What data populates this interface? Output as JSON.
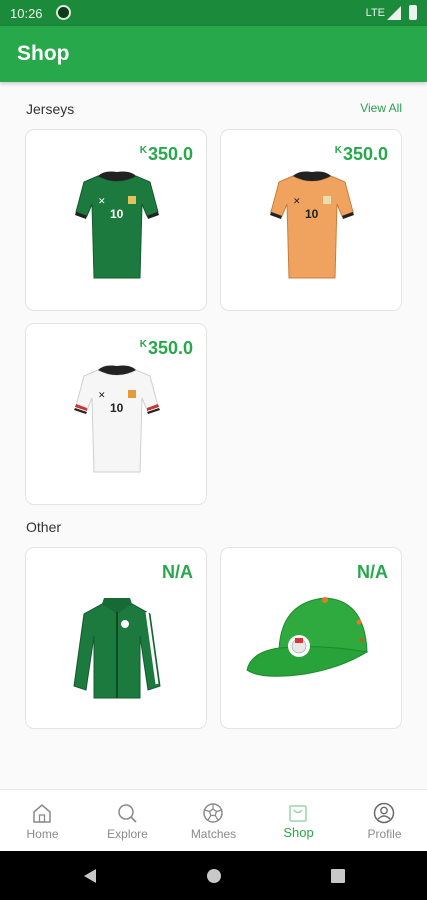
{
  "status_bar": {
    "time": "10:26",
    "network": "LTE"
  },
  "app_bar": {
    "title": "Shop"
  },
  "sections": {
    "jerseys": {
      "label": "Jerseys",
      "view_all": "View All"
    },
    "other": {
      "label": "Other"
    }
  },
  "products": {
    "jersey_green": {
      "currency": "K",
      "price": "350.0",
      "image_icon": "green-jersey-image"
    },
    "jersey_orange": {
      "currency": "K",
      "price": "350.0",
      "image_icon": "orange-jersey-image"
    },
    "jersey_white": {
      "currency": "K",
      "price": "350.0",
      "image_icon": "white-jersey-image"
    },
    "jacket": {
      "price": "N/A",
      "image_icon": "green-jacket-image"
    },
    "cap": {
      "price": "N/A",
      "image_icon": "green-cap-image"
    }
  },
  "bottom_nav": {
    "items": [
      {
        "label": "Home",
        "icon": "home-icon"
      },
      {
        "label": "Explore",
        "icon": "search-icon"
      },
      {
        "label": "Matches",
        "icon": "soccer-ball-icon"
      },
      {
        "label": "Shop",
        "icon": "shopping-bag-icon",
        "active": true
      },
      {
        "label": "Profile",
        "icon": "profile-icon"
      }
    ]
  },
  "colors": {
    "primary": "#27a84b",
    "status_bar": "#1b8a3a",
    "inactive": "#8a8a8a"
  }
}
